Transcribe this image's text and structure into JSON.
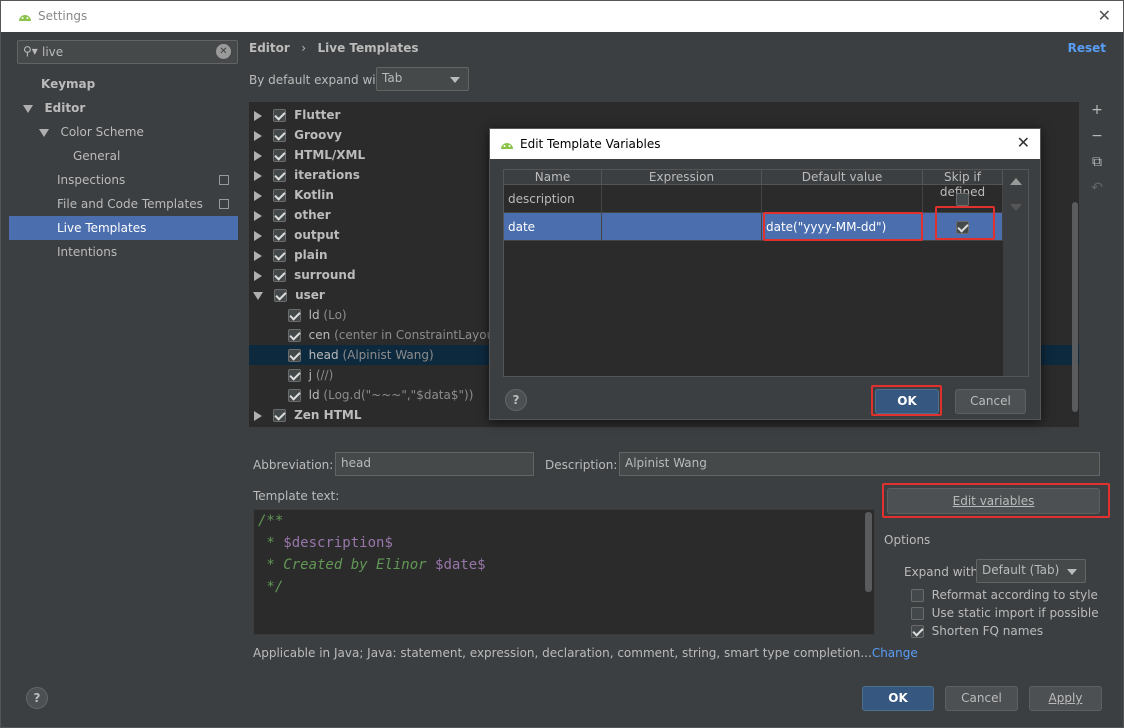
{
  "window": {
    "title": "Settings"
  },
  "search": {
    "value": "live"
  },
  "sidebar": {
    "items": [
      {
        "label": "Keymap"
      },
      {
        "label": "Editor"
      },
      {
        "label": "Color Scheme"
      },
      {
        "label": "General"
      },
      {
        "label": "Inspections"
      },
      {
        "label": "File and Code Templates"
      },
      {
        "label": "Live Templates"
      },
      {
        "label": "Intentions"
      }
    ]
  },
  "breadcrumb": {
    "part1": "Editor",
    "sep": "›",
    "part2": "Live Templates"
  },
  "reset_label": "Reset",
  "expand": {
    "label": "By default expand with",
    "value": "Tab"
  },
  "template_groups": [
    {
      "name": "Flutter"
    },
    {
      "name": "Groovy"
    },
    {
      "name": "HTML/XML"
    },
    {
      "name": "iterations"
    },
    {
      "name": "Kotlin"
    },
    {
      "name": "other"
    },
    {
      "name": "output"
    },
    {
      "name": "plain"
    },
    {
      "name": "surround"
    },
    {
      "name": "user"
    }
  ],
  "user_templates": [
    {
      "abbr": "ld",
      "desc": "(Lo)"
    },
    {
      "abbr": "cen",
      "desc": "(center in ConstraintLayout)"
    },
    {
      "abbr": "head",
      "desc": "(Alpinist Wang)"
    },
    {
      "abbr": "j",
      "desc": "(//)"
    },
    {
      "abbr": "ld",
      "desc": "(Log.d(\"~~~\",\"$data$\"))"
    }
  ],
  "last_group": {
    "name": "Zen HTML"
  },
  "abbreviation": {
    "label": "Abbreviation:",
    "value": "head"
  },
  "description": {
    "label": "Description:",
    "value": "Alpinist Wang"
  },
  "template_text": {
    "label": "Template text:",
    "line1": "/**",
    "line2a": " * ",
    "line2b": "$description$",
    "line3a": " * Created by Elinor ",
    "line3b": "$date$",
    "line4": " */"
  },
  "edit_variables_label": "Edit variables",
  "options": {
    "heading": "Options",
    "expand_label": "Expand with",
    "expand_value": "Default (Tab)",
    "reformat": "Reformat according to style",
    "static_import": "Use static import if possible",
    "shorten": "Shorten FQ names"
  },
  "applicable": {
    "text": "Applicable in Java; Java: statement, expression, declaration, comment, string, smart type completion...",
    "link": "Change"
  },
  "footer": {
    "ok": "OK",
    "cancel": "Cancel",
    "apply": "Apply",
    "help": "?"
  },
  "dialog": {
    "title": "Edit Template Variables",
    "columns": [
      "Name",
      "Expression",
      "Default value",
      "Skip if defined"
    ],
    "rows": [
      {
        "name": "description",
        "expression": "",
        "default": "",
        "skip": false
      },
      {
        "name": "date",
        "expression": "",
        "default": "date(\"yyyy-MM-dd\")",
        "skip": true
      }
    ],
    "ok": "OK",
    "cancel": "Cancel",
    "help": "?"
  },
  "colors": {
    "accent": "#4b6eaf",
    "link": "#589df6",
    "highlight": "#e0312f"
  }
}
